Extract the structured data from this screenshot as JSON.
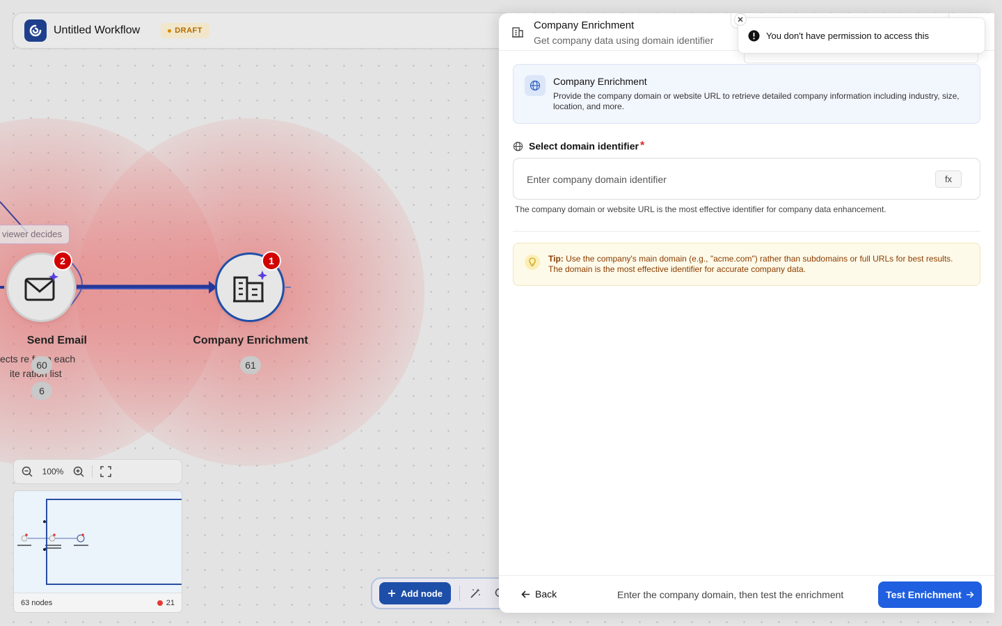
{
  "workflow": {
    "title": "Untitled Workflow",
    "status": "DRAFT"
  },
  "canvas": {
    "edge_label": "viewer decides",
    "nodes": [
      {
        "name": "email-node",
        "badge": "2",
        "label_overlap": "Send Email",
        "sub_lines": [
          "ects re    from each",
          "ite  ration  list"
        ],
        "numbers": [
          "60",
          "6"
        ]
      },
      {
        "name": "company-enrichment-node",
        "badge": "1",
        "label": "Company Enrichment",
        "number": "61"
      }
    ]
  },
  "zoom": {
    "level": "100%"
  },
  "minimap": {
    "node_count": "63 nodes",
    "error_count": "21"
  },
  "toolbar": {
    "add_node_label": "Add node"
  },
  "panel": {
    "title": "Company Enrichment",
    "subtitle": "Get company data using domain identifier",
    "info": {
      "title": "Company Enrichment",
      "description": "Provide the company domain or website URL to retrieve detailed company information including industry, size, location, and more."
    },
    "field": {
      "label": "Select domain identifier",
      "required_marker": "*",
      "value": "",
      "placeholder": "Enter company domain identifier",
      "fx_label": "fx",
      "help": "The company domain or website URL is the most effective identifier for company data enhancement."
    },
    "tip": {
      "prefix": "Tip:",
      "text": "Use the company's main domain (e.g., \"acme.com\") rather than subdomains or full URLs for best results. The domain is the most effective identifier for accurate company data."
    },
    "footer": {
      "back_label": "Back",
      "hint": "Enter the company domain, then test the enrichment",
      "test_label": "Test Enrichment"
    }
  },
  "toast": {
    "message": "You don't have permission to access this"
  },
  "colors": {
    "primary": "#1f5fe0",
    "brand_dark": "#1e4fa8",
    "error": "#d20000",
    "draft": "#b36b00",
    "tip_text": "#8a3c00"
  }
}
